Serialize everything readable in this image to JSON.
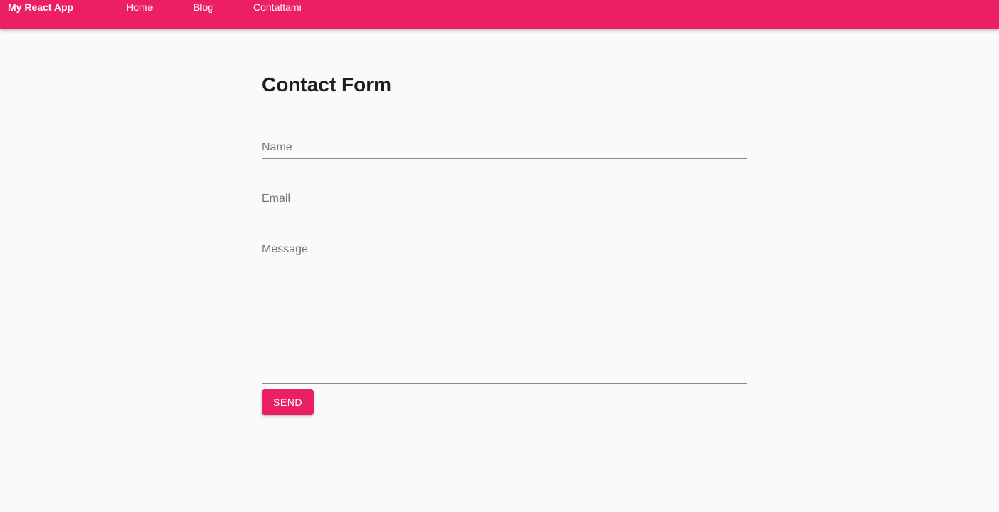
{
  "appbar": {
    "brand": "My React App",
    "links": [
      {
        "label": "Home"
      },
      {
        "label": "Blog"
      },
      {
        "label": "Contattami"
      }
    ],
    "color": "#ec1e64"
  },
  "main": {
    "title": "Contact Form",
    "fields": {
      "name": {
        "placeholder": "Name",
        "value": ""
      },
      "email": {
        "placeholder": "Email",
        "value": ""
      },
      "message": {
        "placeholder": "Message",
        "value": ""
      }
    },
    "send_label": "SEND"
  },
  "colors": {
    "accent": "#ec1e64",
    "background": "#fafafa"
  }
}
